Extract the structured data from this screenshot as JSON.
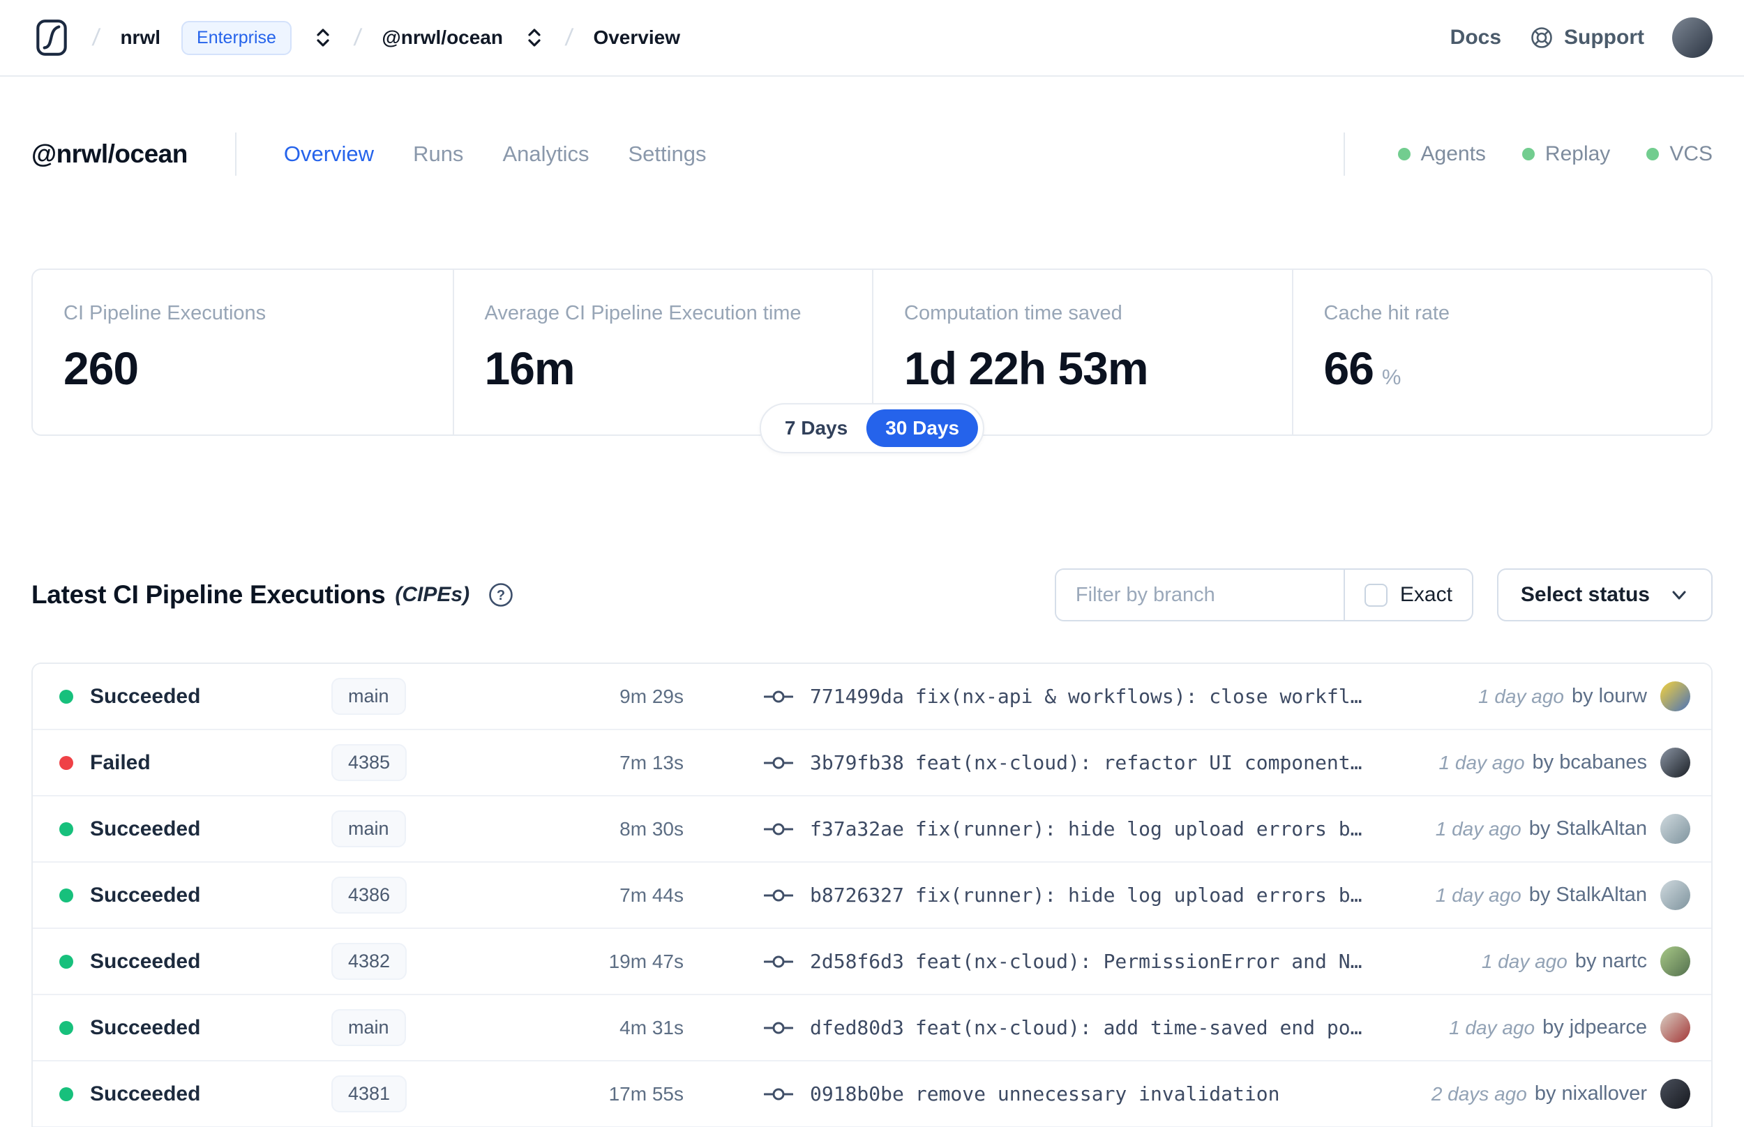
{
  "colors": {
    "accent": "#2563eb",
    "soft_green": "#72cd8f",
    "succeeded_dot": "#17c07c",
    "failed_dot": "#ef4146"
  },
  "topbar": {
    "org": "nrwl",
    "org_badge": "Enterprise",
    "workspace": "@nrwl/ocean",
    "page": "Overview",
    "docs": "Docs",
    "support": "Support",
    "avatar_colors": [
      "#7d8794",
      "#2b3442"
    ]
  },
  "header": {
    "title": "@nrwl/ocean",
    "tabs": [
      {
        "label": "Overview"
      },
      {
        "label": "Runs"
      },
      {
        "label": "Analytics"
      },
      {
        "label": "Settings"
      }
    ],
    "services": [
      {
        "label": "Agents"
      },
      {
        "label": "Replay"
      },
      {
        "label": "VCS"
      }
    ]
  },
  "stats": [
    {
      "label": "CI Pipeline Executions",
      "value": "260",
      "suffix": ""
    },
    {
      "label": "Average CI Pipeline Execution time",
      "value": "16m",
      "suffix": ""
    },
    {
      "label": "Computation time saved",
      "value": "1d 22h 53m",
      "suffix": ""
    },
    {
      "label": "Cache hit rate",
      "value": "66",
      "suffix": "%"
    }
  ],
  "range_toggle": {
    "options": [
      "7 Days",
      "30 Days"
    ],
    "active": "30 Days"
  },
  "section": {
    "title": "Latest CI Pipeline Executions",
    "title_suffix": "(CIPEs)",
    "filter_placeholder": "Filter by branch",
    "exact_label": "Exact",
    "status_dropdown": "Select status"
  },
  "rows": [
    {
      "status": "Succeeded",
      "dot_color": "#17c07c",
      "branch": "main",
      "duration": "9m 29s",
      "commit_hash": "771499da",
      "commit_message": "fix(nx-api & workflows): close workfl…",
      "time_ago": "1 day ago",
      "author": "by lourw",
      "avatar_colors": [
        "#f5d23d",
        "#4a72b8"
      ]
    },
    {
      "status": "Failed",
      "dot_color": "#ef4146",
      "branch": "4385",
      "duration": "7m 13s",
      "commit_hash": "3b79fb38",
      "commit_message": "feat(nx-cloud): refactor UI component…",
      "time_ago": "1 day ago",
      "author": "by bcabanes",
      "avatar_colors": [
        "#8a94a3",
        "#1b2026"
      ]
    },
    {
      "status": "Succeeded",
      "dot_color": "#17c07c",
      "branch": "main",
      "duration": "8m 30s",
      "commit_hash": "f37a32ae",
      "commit_message": "fix(runner): hide log upload errors b…",
      "time_ago": "1 day ago",
      "author": "by StalkAltan",
      "avatar_colors": [
        "#cfd9de",
        "#7f949e"
      ]
    },
    {
      "status": "Succeeded",
      "dot_color": "#17c07c",
      "branch": "4386",
      "duration": "7m 44s",
      "commit_hash": "b8726327",
      "commit_message": "fix(runner): hide log upload errors b…",
      "time_ago": "1 day ago",
      "author": "by StalkAltan",
      "avatar_colors": [
        "#cfd9de",
        "#7f949e"
      ]
    },
    {
      "status": "Succeeded",
      "dot_color": "#17c07c",
      "branch": "4382",
      "duration": "19m 47s",
      "commit_hash": "2d58f6d3",
      "commit_message": "feat(nx-cloud): PermissionError and N…",
      "time_ago": "1 day ago",
      "author": "by nartc",
      "avatar_colors": [
        "#a8c887",
        "#53704e"
      ]
    },
    {
      "status": "Succeeded",
      "dot_color": "#17c07c",
      "branch": "main",
      "duration": "4m 31s",
      "commit_hash": "dfed80d3",
      "commit_message": "feat(nx-cloud): add time-saved end po…",
      "time_ago": "1 day ago",
      "author": "by jdpearce",
      "avatar_colors": [
        "#d8cdc2",
        "#a43737"
      ]
    },
    {
      "status": "Succeeded",
      "dot_color": "#17c07c",
      "branch": "4381",
      "duration": "17m 55s",
      "commit_hash": "0918b0be",
      "commit_message": "remove unnecessary invalidation",
      "time_ago": "2 days ago",
      "author": "by nixallover",
      "avatar_colors": [
        "#4a505c",
        "#17191f"
      ]
    }
  ]
}
